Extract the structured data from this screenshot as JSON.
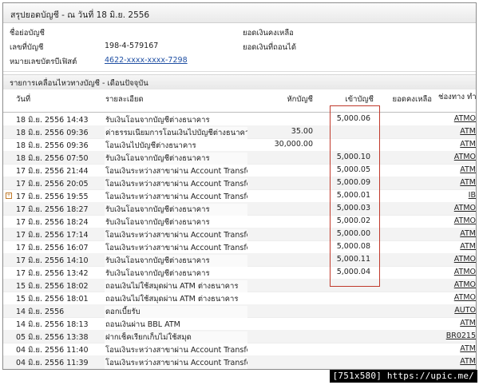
{
  "title": "สรุปยอดบัญชี - ณ วันที่ 18 มิ.ย. 2556",
  "summary": {
    "account_name_label": "ชื่อย่อบัญชี",
    "account_name_value": "",
    "account_no_label": "เลขที่บัญชี",
    "account_no_value": "198-4-579167",
    "card_no_label": "หมายเลขบัตรบีเฟิสต์",
    "card_no_value": "4622-xxxx-xxxx-7298",
    "balance_label": "ยอดเงินคงเหลือ",
    "available_label": "ยอดเงินที่ถอนได้"
  },
  "section_title": "รายการเคลื่อนไหวทางบัญชี - เดือนปัจจุบัน",
  "table": {
    "headers": {
      "date": "วันที่",
      "desc": "รายละเอียด",
      "withdraw": "หักบัญชี",
      "deposit": "เข้าบัญชี",
      "balance": "ยอดคงเหลือ",
      "channel": "ช่องทาง ทำรายการ"
    },
    "rows": [
      {
        "date": "18 มิ.ย. 2556 14:43",
        "desc": "รับเงินโอนจากบัญชีต่างธนาคาร",
        "withdraw": "",
        "deposit": "5,000.06",
        "balance": "",
        "channel": "ATMO"
      },
      {
        "date": "18 มิ.ย. 2556 09:36",
        "desc": "ค่าธรรมเนียมการโอนเงินไปบัญชีต่างธนาคาร",
        "withdraw": "35.00",
        "deposit": "",
        "balance": "",
        "channel": "ATM"
      },
      {
        "date": "18 มิ.ย. 2556 09:36",
        "desc": "โอนเงินไปบัญชีต่างธนาคาร",
        "withdraw": "30,000.00",
        "deposit": "",
        "balance": "",
        "channel": "ATM"
      },
      {
        "date": "18 มิ.ย. 2556 07:50",
        "desc": "รับเงินโอนจากบัญชีต่างธนาคาร",
        "withdraw": "",
        "deposit": "5,000.10",
        "balance": "",
        "channel": "ATMO"
      },
      {
        "date": "17 มิ.ย. 2556 21:44",
        "desc": "โอนเงินระหว่างสาขาผ่าน Account Transfer",
        "withdraw": "",
        "deposit": "5,000.05",
        "balance": "",
        "channel": "ATM"
      },
      {
        "date": "17 มิ.ย. 2556 20:05",
        "desc": "โอนเงินระหว่างสาขาผ่าน Account Transfer",
        "withdraw": "",
        "deposit": "5,000.09",
        "balance": "",
        "channel": "ATM"
      },
      {
        "date": "17 มิ.ย. 2556 19:55",
        "desc": "โอนเงินระหว่างสาขาผ่าน Account Transfer",
        "withdraw": "",
        "deposit": "5,000.01",
        "balance": "",
        "channel": "IB"
      },
      {
        "date": "17 มิ.ย. 2556 18:27",
        "desc": "รับเงินโอนจากบัญชีต่างธนาคาร",
        "withdraw": "",
        "deposit": "5,000.03",
        "balance": "",
        "channel": "ATMO"
      },
      {
        "date": "17 มิ.ย. 2556 18:24",
        "desc": "รับเงินโอนจากบัญชีต่างธนาคาร",
        "withdraw": "",
        "deposit": "5,000.02",
        "balance": "",
        "channel": "ATMO"
      },
      {
        "date": "17 มิ.ย. 2556 17:14",
        "desc": "โอนเงินระหว่างสาขาผ่าน Account Transfer",
        "withdraw": "",
        "deposit": "5,000.00",
        "balance": "",
        "channel": "ATM"
      },
      {
        "date": "17 มิ.ย. 2556 16:07",
        "desc": "โอนเงินระหว่างสาขาผ่าน Account Transfer",
        "withdraw": "",
        "deposit": "5,000.08",
        "balance": "",
        "channel": "ATM"
      },
      {
        "date": "17 มิ.ย. 2556 14:10",
        "desc": "รับเงินโอนจากบัญชีต่างธนาคาร",
        "withdraw": "",
        "deposit": "5,000.11",
        "balance": "",
        "channel": "ATMO"
      },
      {
        "date": "17 มิ.ย. 2556 13:42",
        "desc": "รับเงินโอนจากบัญชีต่างธนาคาร",
        "withdraw": "",
        "deposit": "5,000.04",
        "balance": "",
        "channel": "ATMO"
      },
      {
        "date": "15 มิ.ย. 2556 18:02",
        "desc": "ถอนเงินไม่ใช้สมุดผ่าน ATM ต่างธนาคาร",
        "withdraw": "",
        "deposit": "",
        "balance": "",
        "channel": "ATMO"
      },
      {
        "date": "15 มิ.ย. 2556 18:01",
        "desc": "ถอนเงินไม่ใช้สมุดผ่าน ATM ต่างธนาคาร",
        "withdraw": "",
        "deposit": "",
        "balance": "",
        "channel": "ATMO"
      },
      {
        "date": "14 มิ.ย. 2556",
        "desc": "ดอกเบี้ยรับ",
        "withdraw": "",
        "deposit": "",
        "balance": "",
        "channel": "AUTO"
      },
      {
        "date": "14 มิ.ย. 2556 18:13",
        "desc": "ถอนเงินผ่าน BBL ATM",
        "withdraw": "",
        "deposit": "",
        "balance": "",
        "channel": "ATM"
      },
      {
        "date": "05 มิ.ย. 2556 13:38",
        "desc": "ฝากเช็คเรียกเก็บไม่ใช้สมุด",
        "withdraw": "",
        "deposit": "",
        "balance": "",
        "channel": "BR0215"
      },
      {
        "date": "04 มิ.ย. 2556 11:40",
        "desc": "โอนเงินระหว่างสาขาผ่าน Account Transfer",
        "withdraw": "",
        "deposit": "",
        "balance": "",
        "channel": "ATM"
      },
      {
        "date": "04 มิ.ย. 2556 11:39",
        "desc": "โอนเงินระหว่างสาขาผ่าน Account Transfer",
        "withdraw": "",
        "deposit": "",
        "balance": "",
        "channel": "ATM"
      }
    ]
  },
  "watermark": "[751x580] https://upic.me/",
  "colors": {
    "highlight": "#c0392b",
    "link": "#1f4fa3"
  }
}
